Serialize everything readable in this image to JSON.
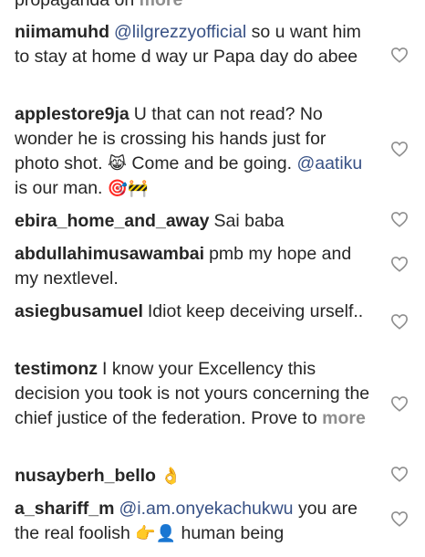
{
  "top_fragment": {
    "text": "propaganda on",
    "more": "more"
  },
  "comments": [
    {
      "user": "niimamuhd",
      "mention": "@lilgrezzyofficial",
      "text": " so u want him to stay at home d way ur Papa day do abee"
    },
    {
      "user": "applestore9ja",
      "text1": "U that can not read? No wonder he is crossing his hands just for photo shot. ",
      "emoji1": "😹",
      "text2": " Come and be going. ",
      "mention": "@aatiku",
      "text3": " is our man. ",
      "emoji2": "🎯🚧"
    },
    {
      "user": "ebira_home_and_away",
      "text": "Sai baba"
    },
    {
      "user": "abdullahimusawambai",
      "text": "pmb my hope and my nextlevel."
    },
    {
      "user": "asiegbusamuel",
      "text": "Idiot keep deceiving urself.."
    },
    {
      "user": "testimonz",
      "text": "I know your Excellency this decision you took is not yours concerning the chief justice of the federation. Prove to ",
      "more": "more"
    },
    {
      "user": "nusayberh_bello",
      "emoji": "👌"
    },
    {
      "user": "a_shariff_m",
      "mention": "@i.am.onyekachukwu",
      "text": " you are the real foolish ",
      "emoji": "👉👤",
      "text2": " human being"
    }
  ],
  "icons": {
    "like": "heart-outline-icon"
  },
  "colors": {
    "text": "#262626",
    "mention": "#385185",
    "muted": "#8e8e8e",
    "icon": "#8e8e8e"
  }
}
